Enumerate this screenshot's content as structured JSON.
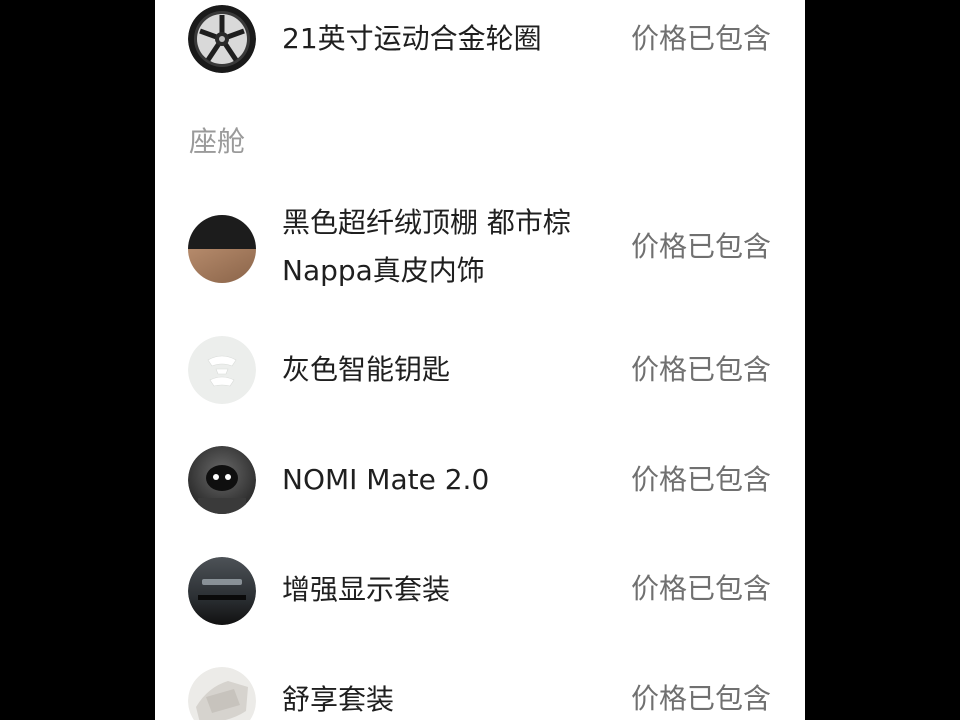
{
  "price_label": "价格已包含",
  "sections": [
    {
      "title": "",
      "items": [
        {
          "name": "21英寸运动合金轮圈",
          "price": "价格已包含",
          "icon": "wheel-icon"
        }
      ]
    },
    {
      "title": "座舱",
      "items": [
        {
          "name_line1": "黑色超纤绒顶棚 都市棕",
          "name_line2": "Nappa真皮内饰",
          "price": "价格已包含",
          "icon": "interior-color-swatch"
        },
        {
          "name": "灰色智能钥匙",
          "price": "价格已包含",
          "icon": "smart-key-icon"
        },
        {
          "name": "NOMI Mate 2.0",
          "price": "价格已包含",
          "icon": "nomi-mate-icon"
        },
        {
          "name": "增强显示套装",
          "price": "价格已包含",
          "icon": "hud-display-icon"
        },
        {
          "name": "舒享套装",
          "price": "价格已包含",
          "icon": "comfort-package-icon"
        }
      ]
    }
  ]
}
